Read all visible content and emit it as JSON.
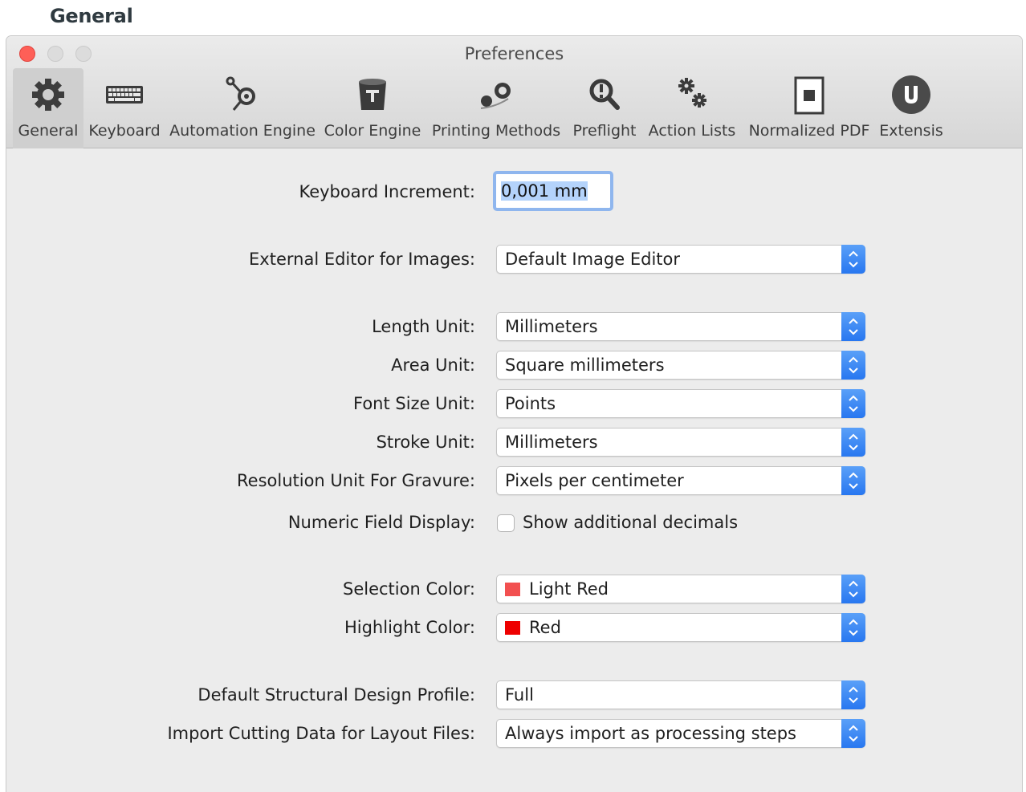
{
  "page_heading": "General",
  "window": {
    "title": "Preferences"
  },
  "toolbar": {
    "items": [
      {
        "label": "General",
        "icon": "gear-icon",
        "selected": true
      },
      {
        "label": "Keyboard",
        "icon": "keyboard-icon"
      },
      {
        "label": "Automation Engine",
        "icon": "automation-engine-icon"
      },
      {
        "label": "Color Engine",
        "icon": "color-engine-icon"
      },
      {
        "label": "Printing Methods",
        "icon": "printing-methods-icon"
      },
      {
        "label": "Preflight",
        "icon": "preflight-icon"
      },
      {
        "label": "Action Lists",
        "icon": "action-lists-icon"
      },
      {
        "label": "Normalized PDF",
        "icon": "normalized-pdf-icon"
      },
      {
        "label": "Extensis",
        "icon": "extensis-icon"
      }
    ]
  },
  "form": {
    "keyboard_increment": {
      "label": "Keyboard Increment:",
      "value": "0,001 mm"
    },
    "external_editor": {
      "label": "External Editor for Images:",
      "value": "Default Image Editor"
    },
    "length_unit": {
      "label": "Length Unit:",
      "value": "Millimeters"
    },
    "area_unit": {
      "label": "Area Unit:",
      "value": "Square millimeters"
    },
    "font_size_unit": {
      "label": "Font Size Unit:",
      "value": "Points"
    },
    "stroke_unit": {
      "label": "Stroke Unit:",
      "value": "Millimeters"
    },
    "resolution_unit": {
      "label": "Resolution Unit For Gravure:",
      "value": "Pixels per centimeter"
    },
    "numeric_display": {
      "label": "Numeric Field Display:",
      "checkbox_label": "Show additional decimals",
      "checked": false
    },
    "selection_color": {
      "label": "Selection Color:",
      "value": "Light Red",
      "swatch": "#f25050"
    },
    "highlight_color": {
      "label": "Highlight Color:",
      "value": "Red",
      "swatch": "#ee0000"
    },
    "structural_profile": {
      "label": "Default Structural Design Profile:",
      "value": "Full"
    },
    "import_cutting": {
      "label": "Import Cutting Data for Layout Files:",
      "value": "Always import as processing steps"
    }
  },
  "colors": {
    "accent": "#2f7bf2",
    "selection_highlight": "#b4d3fb",
    "close": "#fe5f57"
  }
}
